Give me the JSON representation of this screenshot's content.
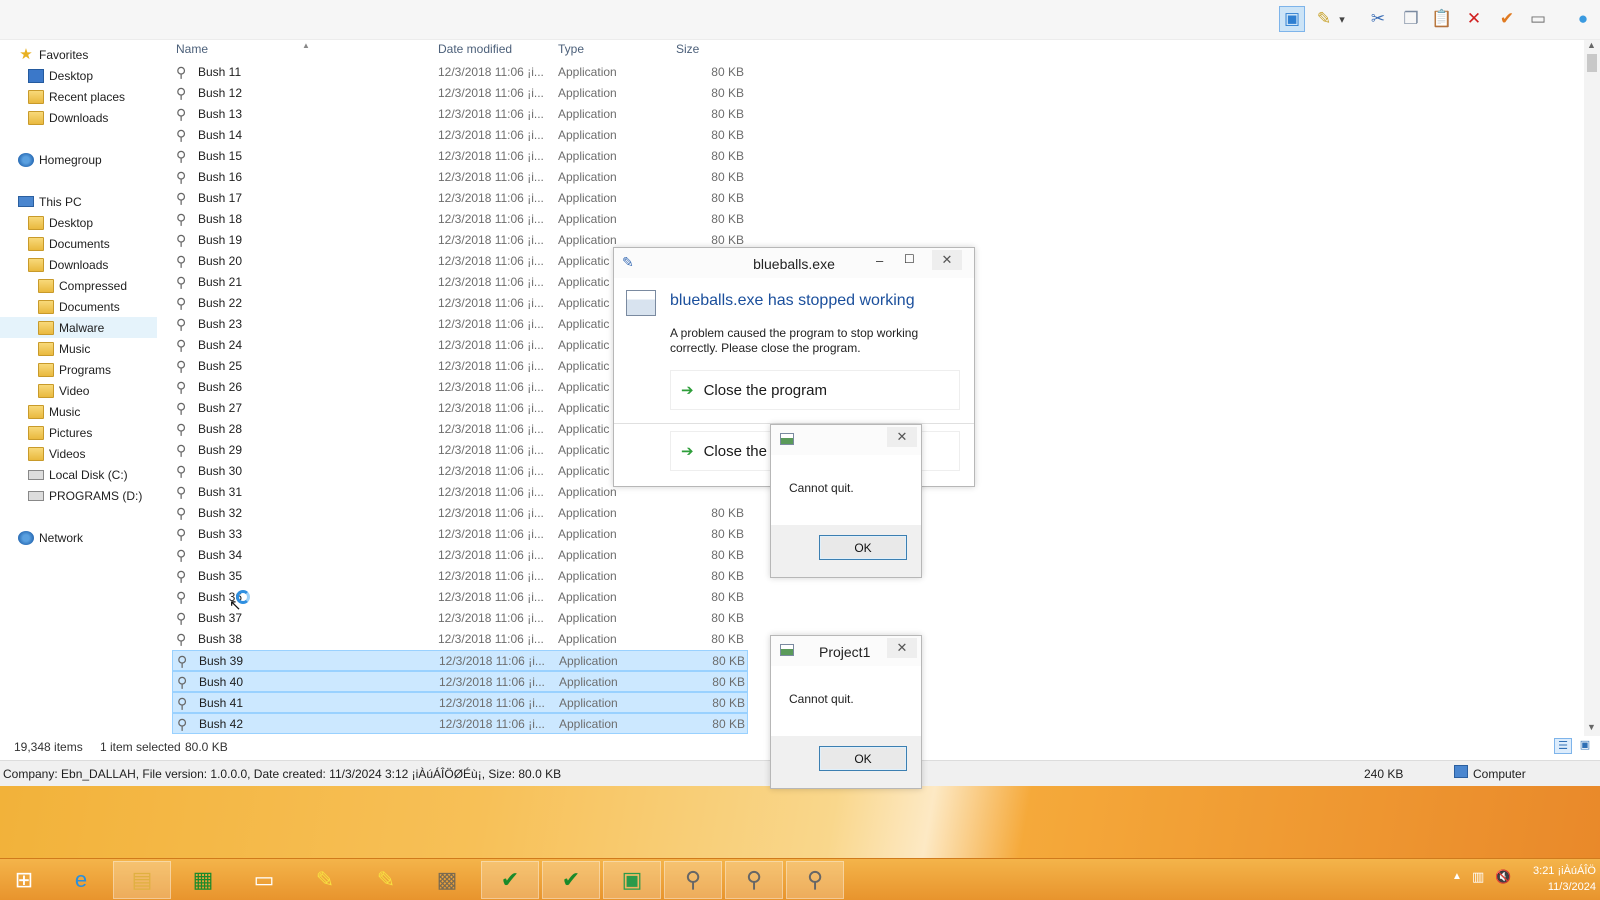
{
  "toolbar": {
    "buttons": [
      {
        "name": "layout-pane-button",
        "glyph": "▣",
        "color": "#2f7fd1",
        "active": true
      },
      {
        "name": "properties-button",
        "glyph": "✎",
        "color": "#c8a22a"
      },
      {
        "name": "dropdown-arrow",
        "glyph": "▾",
        "color": "#444"
      },
      {
        "name": "cut-button",
        "glyph": "✂",
        "color": "#3a6db5"
      },
      {
        "name": "copy-button",
        "glyph": "❐",
        "color": "#7a8aa0"
      },
      {
        "name": "paste-button",
        "glyph": "📋",
        "color": "#9a7a3a"
      },
      {
        "name": "delete-button",
        "glyph": "✕",
        "color": "#d02020"
      },
      {
        "name": "check-button",
        "glyph": "✔",
        "color": "#e07a20"
      },
      {
        "name": "rename-button",
        "glyph": "▭",
        "color": "#6d6d6d"
      },
      {
        "name": "globe-button",
        "glyph": "●",
        "color": "#3a9ae0"
      }
    ]
  },
  "nav": {
    "items": [
      {
        "label": "Favorites",
        "icon": "star",
        "indent": 0,
        "top": 0
      },
      {
        "label": "Desktop",
        "icon": "desk",
        "indent": 1
      },
      {
        "label": "Recent places",
        "icon": "folder",
        "indent": 1
      },
      {
        "label": "Downloads",
        "icon": "folder",
        "indent": 1
      },
      {
        "label": "Homegroup",
        "icon": "net",
        "indent": 0,
        "gap": true
      },
      {
        "label": "This PC",
        "icon": "pc",
        "indent": 0,
        "gap": true
      },
      {
        "label": "Desktop",
        "icon": "folder",
        "indent": 1
      },
      {
        "label": "Documents",
        "icon": "folder",
        "indent": 1
      },
      {
        "label": "Downloads",
        "icon": "folder",
        "indent": 1
      },
      {
        "label": "Compressed",
        "icon": "folder",
        "indent": 2
      },
      {
        "label": "Documents",
        "icon": "folder",
        "indent": 2
      },
      {
        "label": "Malware",
        "icon": "folder",
        "indent": 2,
        "selected": true
      },
      {
        "label": "Music",
        "icon": "folder",
        "indent": 2
      },
      {
        "label": "Programs",
        "icon": "folder",
        "indent": 2
      },
      {
        "label": "Video",
        "icon": "folder",
        "indent": 2
      },
      {
        "label": "Music",
        "icon": "folder",
        "indent": 1
      },
      {
        "label": "Pictures",
        "icon": "folder",
        "indent": 1
      },
      {
        "label": "Videos",
        "icon": "folder",
        "indent": 1
      },
      {
        "label": "Local Disk (C:)",
        "icon": "drive",
        "indent": 1
      },
      {
        "label": "PROGRAMS (D:)",
        "icon": "drive",
        "indent": 1
      },
      {
        "label": "Network",
        "icon": "net",
        "indent": 0,
        "gap": true
      }
    ]
  },
  "columns": {
    "name": "Name",
    "date": "Date modified",
    "type": "Type",
    "size": "Size"
  },
  "files": {
    "date": "12/3/2018 11:06 ¡i...",
    "type": "Application",
    "type_truncated": "Applicatic",
    "size": "80 KB",
    "rows": [
      {
        "name": "Bush 11"
      },
      {
        "name": "Bush 12"
      },
      {
        "name": "Bush 13"
      },
      {
        "name": "Bush 14"
      },
      {
        "name": "Bush 15"
      },
      {
        "name": "Bush 16"
      },
      {
        "name": "Bush 17"
      },
      {
        "name": "Bush 18"
      },
      {
        "name": "Bush 19"
      },
      {
        "name": "Bush 20"
      },
      {
        "name": "Bush 21"
      },
      {
        "name": "Bush 22"
      },
      {
        "name": "Bush 23"
      },
      {
        "name": "Bush 24"
      },
      {
        "name": "Bush 25"
      },
      {
        "name": "Bush 26"
      },
      {
        "name": "Bush 27"
      },
      {
        "name": "Bush 28"
      },
      {
        "name": "Bush 29"
      },
      {
        "name": "Bush 30"
      },
      {
        "name": "Bush 31"
      },
      {
        "name": "Bush 32"
      },
      {
        "name": "Bush 33"
      },
      {
        "name": "Bush 34"
      },
      {
        "name": "Bush 35"
      },
      {
        "name": "Bush 36"
      },
      {
        "name": "Bush 37"
      },
      {
        "name": "Bush 38"
      },
      {
        "name": "Bush 39",
        "selected": true
      },
      {
        "name": "Bush 40",
        "selected": true
      },
      {
        "name": "Bush 41",
        "selected": true
      },
      {
        "name": "Bush 42",
        "selected": true
      }
    ]
  },
  "status": {
    "count": "19,348 items",
    "selected": "1 item selected",
    "selected_size": "80.0 KB"
  },
  "details": {
    "text": "Company: Ebn_DALLAH, File version: 1.0.0.0, Date created: 11/3/2024 3:12 ¡iÀúÁÎÖØÉù¡, Size: 80.0 KB",
    "size": "240 KB",
    "location": "Computer"
  },
  "dialog_main": {
    "title": "blueballs.exe",
    "heading": "blueballs.exe has stopped working",
    "message": "A problem caused the program to stop working correctly. Please close the program.",
    "action1": "Close the program",
    "action2": "Close the"
  },
  "dialog_small1": {
    "title": "",
    "message": "Cannot quit.",
    "ok": "OK"
  },
  "dialog_small2": {
    "title": "Project1",
    "message": "Cannot quit.",
    "ok": "OK"
  },
  "taskbar": {
    "clock_time": "3:21 ¡iÀúÁÎÖ",
    "clock_date": "11/3/2024",
    "tasks": [
      {
        "name": "start-button",
        "glyph": "⊞",
        "color": "#ffffff"
      },
      {
        "name": "task-internet-explorer",
        "glyph": "e",
        "color": "#2b8fdc"
      },
      {
        "name": "task-file-explorer",
        "glyph": "▤",
        "color": "#e0b040",
        "open": true
      },
      {
        "name": "task-store",
        "glyph": "▦",
        "color": "#1a8a2a"
      },
      {
        "name": "task-folder",
        "glyph": "▭",
        "color": "#ffffff"
      },
      {
        "name": "task-app-1",
        "glyph": "✎",
        "color": "#f7e040"
      },
      {
        "name": "task-app-2",
        "glyph": "✎",
        "color": "#f7e040"
      },
      {
        "name": "task-app-3",
        "glyph": "▩",
        "color": "#7a6a50"
      },
      {
        "name": "task-app-4",
        "glyph": "✔",
        "color": "#1a8a2a",
        "open": true
      },
      {
        "name": "task-app-5",
        "glyph": "✔",
        "color": "#1a8a2a",
        "open": true
      },
      {
        "name": "task-app-6",
        "glyph": "▣",
        "color": "#2a9a4a",
        "open": true
      },
      {
        "name": "task-app-7",
        "glyph": "⚲",
        "color": "#666666",
        "open": true
      },
      {
        "name": "task-app-8",
        "glyph": "⚲",
        "color": "#666666",
        "open": true
      },
      {
        "name": "task-app-9",
        "glyph": "⚲",
        "color": "#666666",
        "open": true
      }
    ]
  }
}
